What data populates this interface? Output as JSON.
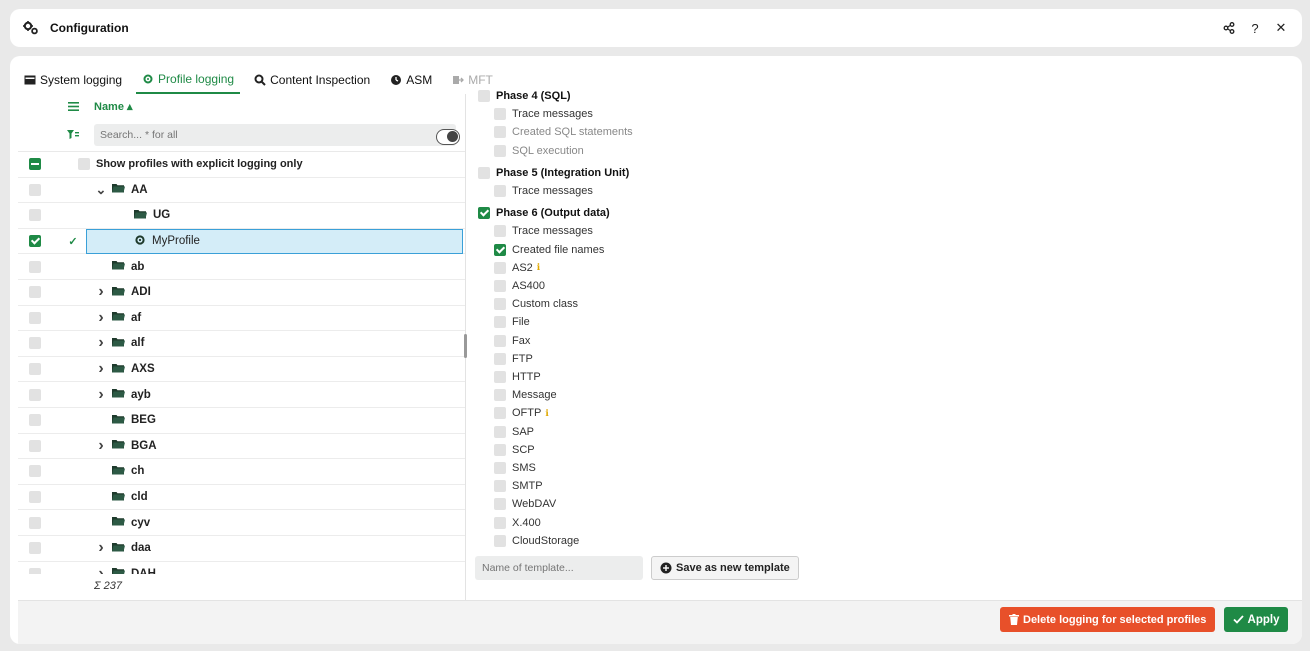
{
  "window": {
    "title": "Configuration"
  },
  "tabs": [
    {
      "label": "System logging",
      "icon": "terminal-icon",
      "state": "normal"
    },
    {
      "label": "Profile logging",
      "icon": "profile-gear-icon",
      "state": "active"
    },
    {
      "label": "Content Inspection",
      "icon": "search-icon",
      "state": "normal"
    },
    {
      "label": "ASM",
      "icon": "clock-icon",
      "state": "normal"
    },
    {
      "label": "MFT",
      "icon": "mft-icon",
      "state": "disabled"
    }
  ],
  "tree": {
    "column_name": "Name",
    "search_placeholder": "Search... * for all",
    "explicit_only_label": "Show profiles with explicit logging only",
    "rows": [
      {
        "label": "AA",
        "indent": 0,
        "arrow": "down",
        "icon": "folder",
        "checked": false,
        "selected": false
      },
      {
        "label": "UG",
        "indent": 1,
        "arrow": "",
        "icon": "folder",
        "checked": false,
        "selected": false
      },
      {
        "label": "MyProfile",
        "indent": 1,
        "arrow": "",
        "icon": "profile",
        "checked": true,
        "selected": true
      },
      {
        "label": "ab",
        "indent": 0,
        "arrow": "",
        "icon": "folder",
        "checked": false,
        "selected": false
      },
      {
        "label": "ADI",
        "indent": 0,
        "arrow": "right",
        "icon": "folder",
        "checked": false,
        "selected": false
      },
      {
        "label": "af",
        "indent": 0,
        "arrow": "right",
        "icon": "folder",
        "checked": false,
        "selected": false
      },
      {
        "label": "alf",
        "indent": 0,
        "arrow": "right",
        "icon": "folder",
        "checked": false,
        "selected": false
      },
      {
        "label": "AXS",
        "indent": 0,
        "arrow": "right",
        "icon": "folder",
        "checked": false,
        "selected": false
      },
      {
        "label": "ayb",
        "indent": 0,
        "arrow": "right",
        "icon": "folder",
        "checked": false,
        "selected": false
      },
      {
        "label": "BEG",
        "indent": 0,
        "arrow": "",
        "icon": "folder",
        "checked": false,
        "selected": false
      },
      {
        "label": "BGA",
        "indent": 0,
        "arrow": "right",
        "icon": "folder",
        "checked": false,
        "selected": false
      },
      {
        "label": "ch",
        "indent": 0,
        "arrow": "",
        "icon": "folder",
        "checked": false,
        "selected": false
      },
      {
        "label": "cld",
        "indent": 0,
        "arrow": "",
        "icon": "folder",
        "checked": false,
        "selected": false
      },
      {
        "label": "cyv",
        "indent": 0,
        "arrow": "",
        "icon": "folder",
        "checked": false,
        "selected": false
      },
      {
        "label": "daa",
        "indent": 0,
        "arrow": "right",
        "icon": "folder",
        "checked": false,
        "selected": false
      },
      {
        "label": "DAH",
        "indent": 0,
        "arrow": "right",
        "icon": "folder",
        "checked": false,
        "selected": false
      }
    ],
    "total": "Σ 237"
  },
  "options": [
    {
      "label": "Phase 4 (SQL)",
      "kind": "phase",
      "checked": false
    },
    {
      "label": "Trace messages",
      "kind": "item",
      "checked": false
    },
    {
      "label": "Created SQL statements",
      "kind": "dim",
      "checked": false
    },
    {
      "label": "SQL execution",
      "kind": "dim",
      "checked": false
    },
    {
      "label": "Phase 5 (Integration Unit)",
      "kind": "phase",
      "checked": false
    },
    {
      "label": "Trace messages",
      "kind": "item",
      "checked": false
    },
    {
      "label": "Phase 6 (Output data)",
      "kind": "phase",
      "checked": true
    },
    {
      "label": "Trace messages",
      "kind": "item",
      "checked": false
    },
    {
      "label": "Created file names",
      "kind": "item",
      "checked": true
    },
    {
      "label": "AS2",
      "kind": "item",
      "checked": false,
      "info": true
    },
    {
      "label": "AS400",
      "kind": "item",
      "checked": false
    },
    {
      "label": "Custom class",
      "kind": "item",
      "checked": false
    },
    {
      "label": "File",
      "kind": "item",
      "checked": false
    },
    {
      "label": "Fax",
      "kind": "item",
      "checked": false
    },
    {
      "label": "FTP",
      "kind": "item",
      "checked": false
    },
    {
      "label": "HTTP",
      "kind": "item",
      "checked": false
    },
    {
      "label": "Message",
      "kind": "item",
      "checked": false
    },
    {
      "label": "OFTP",
      "kind": "item",
      "checked": false,
      "info": true
    },
    {
      "label": "SAP",
      "kind": "item",
      "checked": false
    },
    {
      "label": "SCP",
      "kind": "item",
      "checked": false
    },
    {
      "label": "SMS",
      "kind": "item",
      "checked": false
    },
    {
      "label": "SMTP",
      "kind": "item",
      "checked": false
    },
    {
      "label": "WebDAV",
      "kind": "item",
      "checked": false
    },
    {
      "label": "X.400",
      "kind": "item",
      "checked": false
    },
    {
      "label": "CloudStorage",
      "kind": "item",
      "checked": false
    }
  ],
  "template": {
    "placeholder": "Name of template...",
    "save_label": "Save as new template"
  },
  "actions": {
    "delete_label": "Delete logging for selected profiles",
    "apply_label": "Apply"
  },
  "colors": {
    "accent": "#1f8a46",
    "danger": "#e8502a",
    "selection": "#d4edf8"
  }
}
